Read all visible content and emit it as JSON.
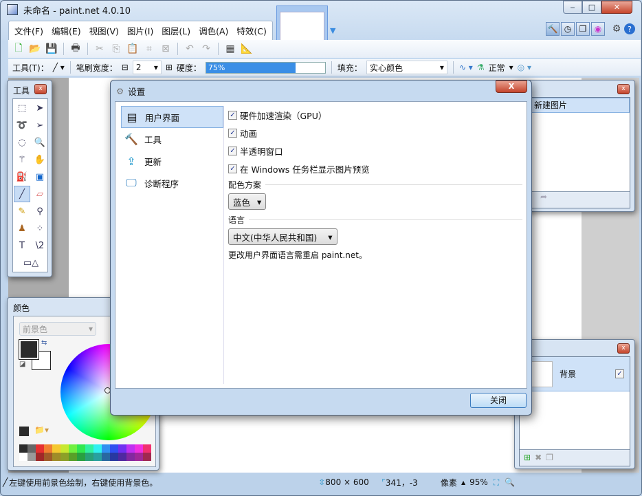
{
  "window": {
    "title": "未命名 - paint.net 4.0.10",
    "minimize": "‒",
    "maximize": "□",
    "close": "✕"
  },
  "menu": [
    "文件(F)",
    "编辑(E)",
    "视图(V)",
    "图片(I)",
    "图层(L)",
    "调色(A)",
    "特效(C)"
  ],
  "toolbar2": {
    "tool_label": "工具(T)：",
    "brush_width_label": "笔刷宽度：",
    "brush_width": "2",
    "hardness_label": "硬度：",
    "hardness": "75%",
    "hardness_value": 0.75,
    "fill_label": "填充：",
    "fill_value": "实心颜色",
    "blend_mode": "正常"
  },
  "tools_panel": {
    "title": "工具"
  },
  "colors_panel": {
    "title": "颜色",
    "mode": "前景色",
    "primary": "#2b2b2b",
    "secondary": "#ffffff"
  },
  "palette": {
    "top": [
      "#2b2b2b",
      "#666666",
      "#e63030",
      "#f07f30",
      "#f5c830",
      "#c8e830",
      "#70f040",
      "#30e850",
      "#30f0a0",
      "#30f0f0",
      "#3090f0",
      "#3050f0",
      "#7030f0",
      "#c030f0",
      "#f030e0",
      "#f03070"
    ],
    "bottom": [
      "#ffffff",
      "#999999",
      "#a02828",
      "#a05a28",
      "#a08c28",
      "#8ca028",
      "#58a028",
      "#28a040",
      "#28a078",
      "#28a0a0",
      "#2868a0",
      "#2838a0",
      "#5028a0",
      "#8428a0",
      "#a02898",
      "#a02850"
    ]
  },
  "history_panel": {
    "item": "新建图片"
  },
  "layers_panel": {
    "layer": "背景"
  },
  "dialog": {
    "title": "设置",
    "nav": [
      "用户界面",
      "工具",
      "更新",
      "诊断程序"
    ],
    "options": [
      "硬件加速渲染（GPU）",
      "动画",
      "半透明窗口",
      "在 Windows 任务栏显示图片预览"
    ],
    "scheme_label": "配色方案",
    "scheme_value": "蓝色",
    "language_label": "语言",
    "language_value": "中文(中华人民共和国)",
    "language_note": "更改用户界面语言需重启 paint.net。",
    "close_button": "关闭"
  },
  "status": {
    "hint": "左键使用前景色绘制，右键使用背景色。",
    "size": "800 × 600",
    "cursor": "341，-3",
    "unit": "像素",
    "zoom": "95%"
  }
}
